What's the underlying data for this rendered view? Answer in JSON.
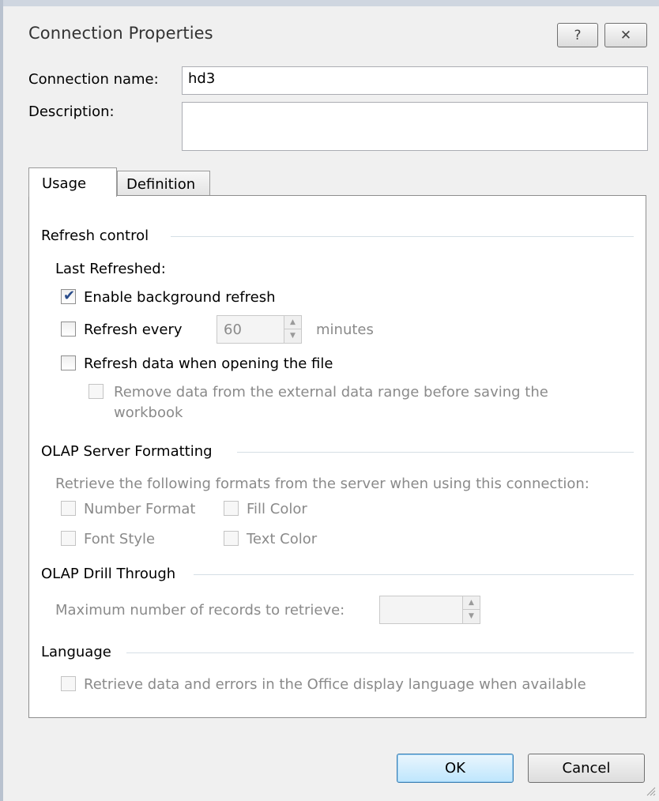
{
  "dialog": {
    "title": "Connection Properties",
    "help_glyph": "?",
    "close_glyph": "✕"
  },
  "fields": {
    "name_label": "Connection name:",
    "name_value": "hd3",
    "description_label": "Description:",
    "description_value": ""
  },
  "tabs": [
    {
      "label": "Usage",
      "active": true
    },
    {
      "label": "Definition",
      "active": false
    }
  ],
  "refresh": {
    "section": "Refresh control",
    "last_refreshed": "Last Refreshed:",
    "enable_background": {
      "label": "Enable background refresh",
      "checked": true
    },
    "refresh_every": {
      "label": "Refresh every",
      "checked": false,
      "value": "60",
      "unit": "minutes"
    },
    "refresh_on_open": {
      "label": "Refresh data when opening the file",
      "checked": false
    },
    "remove_data": {
      "label_line1": "Remove data from the external data range before saving the",
      "label_line2": "workbook",
      "checked": false
    }
  },
  "olap_formatting": {
    "section": "OLAP Server Formatting",
    "description": "Retrieve the following formats from the server when using this connection:",
    "number_format": "Number Format",
    "fill_color": "Fill Color",
    "font_style": "Font Style",
    "text_color": "Text Color"
  },
  "olap_drill": {
    "section": "OLAP Drill Through",
    "max_records_label": "Maximum number of records to retrieve:",
    "max_records_value": ""
  },
  "language": {
    "section": "Language",
    "office_language": "Retrieve data and errors in the Office display language when available"
  },
  "buttons": {
    "ok": "OK",
    "cancel": "Cancel"
  }
}
